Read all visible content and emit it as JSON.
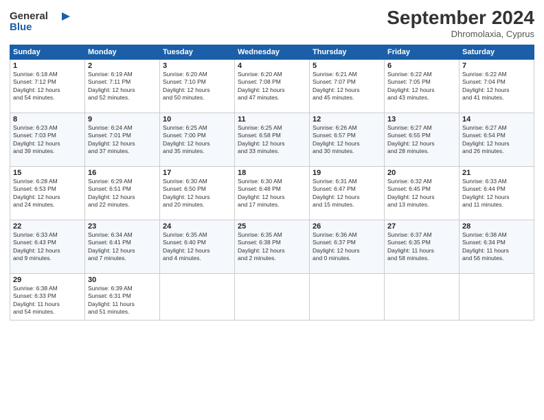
{
  "header": {
    "logo_line1": "General",
    "logo_line2": "Blue",
    "month": "September 2024",
    "location": "Dhromolaxia, Cyprus"
  },
  "days_of_week": [
    "Sunday",
    "Monday",
    "Tuesday",
    "Wednesday",
    "Thursday",
    "Friday",
    "Saturday"
  ],
  "weeks": [
    [
      {
        "day": "1",
        "sunrise": "6:18 AM",
        "sunset": "7:12 PM",
        "daylight": "12 hours and 54 minutes."
      },
      {
        "day": "2",
        "sunrise": "6:19 AM",
        "sunset": "7:11 PM",
        "daylight": "12 hours and 52 minutes."
      },
      {
        "day": "3",
        "sunrise": "6:20 AM",
        "sunset": "7:10 PM",
        "daylight": "12 hours and 50 minutes."
      },
      {
        "day": "4",
        "sunrise": "6:20 AM",
        "sunset": "7:08 PM",
        "daylight": "12 hours and 47 minutes."
      },
      {
        "day": "5",
        "sunrise": "6:21 AM",
        "sunset": "7:07 PM",
        "daylight": "12 hours and 45 minutes."
      },
      {
        "day": "6",
        "sunrise": "6:22 AM",
        "sunset": "7:05 PM",
        "daylight": "12 hours and 43 minutes."
      },
      {
        "day": "7",
        "sunrise": "6:22 AM",
        "sunset": "7:04 PM",
        "daylight": "12 hours and 41 minutes."
      }
    ],
    [
      {
        "day": "8",
        "sunrise": "6:23 AM",
        "sunset": "7:03 PM",
        "daylight": "12 hours and 39 minutes."
      },
      {
        "day": "9",
        "sunrise": "6:24 AM",
        "sunset": "7:01 PM",
        "daylight": "12 hours and 37 minutes."
      },
      {
        "day": "10",
        "sunrise": "6:25 AM",
        "sunset": "7:00 PM",
        "daylight": "12 hours and 35 minutes."
      },
      {
        "day": "11",
        "sunrise": "6:25 AM",
        "sunset": "6:58 PM",
        "daylight": "12 hours and 33 minutes."
      },
      {
        "day": "12",
        "sunrise": "6:26 AM",
        "sunset": "6:57 PM",
        "daylight": "12 hours and 30 minutes."
      },
      {
        "day": "13",
        "sunrise": "6:27 AM",
        "sunset": "6:55 PM",
        "daylight": "12 hours and 28 minutes."
      },
      {
        "day": "14",
        "sunrise": "6:27 AM",
        "sunset": "6:54 PM",
        "daylight": "12 hours and 26 minutes."
      }
    ],
    [
      {
        "day": "15",
        "sunrise": "6:28 AM",
        "sunset": "6:53 PM",
        "daylight": "12 hours and 24 minutes."
      },
      {
        "day": "16",
        "sunrise": "6:29 AM",
        "sunset": "6:51 PM",
        "daylight": "12 hours and 22 minutes."
      },
      {
        "day": "17",
        "sunrise": "6:30 AM",
        "sunset": "6:50 PM",
        "daylight": "12 hours and 20 minutes."
      },
      {
        "day": "18",
        "sunrise": "6:30 AM",
        "sunset": "6:48 PM",
        "daylight": "12 hours and 17 minutes."
      },
      {
        "day": "19",
        "sunrise": "6:31 AM",
        "sunset": "6:47 PM",
        "daylight": "12 hours and 15 minutes."
      },
      {
        "day": "20",
        "sunrise": "6:32 AM",
        "sunset": "6:45 PM",
        "daylight": "12 hours and 13 minutes."
      },
      {
        "day": "21",
        "sunrise": "6:33 AM",
        "sunset": "6:44 PM",
        "daylight": "12 hours and 11 minutes."
      }
    ],
    [
      {
        "day": "22",
        "sunrise": "6:33 AM",
        "sunset": "6:43 PM",
        "daylight": "12 hours and 9 minutes."
      },
      {
        "day": "23",
        "sunrise": "6:34 AM",
        "sunset": "6:41 PM",
        "daylight": "12 hours and 7 minutes."
      },
      {
        "day": "24",
        "sunrise": "6:35 AM",
        "sunset": "6:40 PM",
        "daylight": "12 hours and 4 minutes."
      },
      {
        "day": "25",
        "sunrise": "6:35 AM",
        "sunset": "6:38 PM",
        "daylight": "12 hours and 2 minutes."
      },
      {
        "day": "26",
        "sunrise": "6:36 AM",
        "sunset": "6:37 PM",
        "daylight": "12 hours and 0 minutes."
      },
      {
        "day": "27",
        "sunrise": "6:37 AM",
        "sunset": "6:35 PM",
        "daylight": "11 hours and 58 minutes."
      },
      {
        "day": "28",
        "sunrise": "6:38 AM",
        "sunset": "6:34 PM",
        "daylight": "11 hours and 56 minutes."
      }
    ],
    [
      {
        "day": "29",
        "sunrise": "6:38 AM",
        "sunset": "6:33 PM",
        "daylight": "11 hours and 54 minutes."
      },
      {
        "day": "30",
        "sunrise": "6:39 AM",
        "sunset": "6:31 PM",
        "daylight": "11 hours and 51 minutes."
      },
      null,
      null,
      null,
      null,
      null
    ]
  ]
}
